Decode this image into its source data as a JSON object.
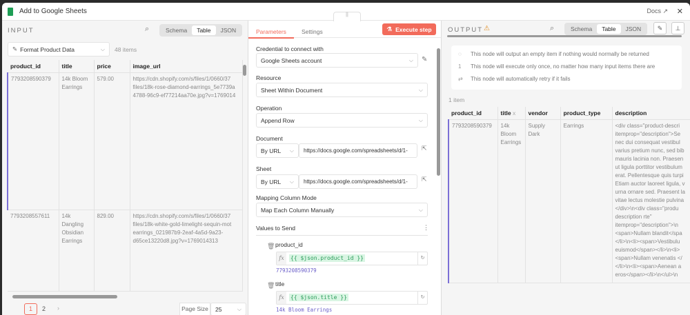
{
  "header": {
    "title": "Add to Google Sheets",
    "docs": "Docs ↗",
    "close": "✕",
    "grip": "||"
  },
  "input": {
    "title": "INPUT",
    "views": [
      "Schema",
      "Table",
      "JSON"
    ],
    "node": "Format Product Data",
    "count": "48 items",
    "columns": [
      "product_id",
      "title",
      "price",
      "image_url"
    ],
    "rows": [
      [
        "7793208590379",
        "14k Bloom\nEarrings",
        "579.00",
        "https://cdn.shopify.com/s/files/1/0660/37\nfiles/18k-rose-diamond-earrings_5e7739a\n4788-96c9-ef77214aa70e.jpg?v=1769014"
      ],
      [
        "7793208557611",
        "14k\nDangling\nObsidian\nEarrings",
        "829.00",
        "https://cdn.shopify.com/s/files/1/0660/37\nfiles/18k-white-gold-limelight-sequin-mot\nearrings_021987b9-2eaf-4a5d-9a23-\nd65ce13220d8.jpg?v=1769014313"
      ]
    ],
    "pages": [
      "1",
      "2"
    ],
    "page_size_label": "Page Size",
    "page_size": "25"
  },
  "params": {
    "tabs": [
      "Parameters",
      "Settings"
    ],
    "execute": "Execute step",
    "credential_label": "Credential to connect with",
    "credential": "Google Sheets account",
    "resource_label": "Resource",
    "resource": "Sheet Within Document",
    "operation_label": "Operation",
    "operation": "Append Row",
    "document_label": "Document",
    "document_mode": "By URL",
    "document_url": "https://docs.google.com/spreadsheets/d/1-",
    "sheet_label": "Sheet",
    "sheet_mode": "By URL",
    "sheet_url": "https://docs.google.com/spreadsheets/d/1-",
    "mapping_label": "Mapping Column Mode",
    "mapping": "Map Each Column Manually",
    "values_label": "Values to Send",
    "fields": [
      {
        "name": "product_id",
        "expr": "{{ $json.product_id }}",
        "result": "7793208590379"
      },
      {
        "name": "title",
        "expr": "{{ $json.title }}",
        "result": "14k Bloom Earrings"
      }
    ]
  },
  "output": {
    "title": "OUTPUT",
    "views": [
      "Schema",
      "Table",
      "JSON"
    ],
    "notes": [
      "This node will output an empty item if nothing would normally be returned",
      "This node will execute only once, no matter how many input items there are",
      "This node will automatically retry if it fails"
    ],
    "count": "1 item",
    "columns": [
      "product_id",
      "title",
      "vendor",
      "product_type",
      "description"
    ],
    "row": [
      "7793208590379",
      "14k\nBloom\nEarrings",
      "Supply\nDark",
      "Earrings",
      "<div class=\"product-descri\nitemprop=\"description\">Se\nnec dui consequat vestibul\nvarius pretium nunc, sed bib\nmauris lacinia non. Praesen\nut ligula porttitor vestibulum\nerat. Pellentesque quis turpi\nEtiam auctor laoreet ligula, v\nurna ornare sed. Praesent la\nvitae lectus molestie pulvina\n</div>\\n<div class=\"produ\ndescription rte\"\nitemprop=\"description\">\\n\n<span>Nullam blandit</spa\n</li>\\n<li><span>Vestibulu\neuismod</span></li>\\n<li>\n<span>Nullam venenatis </\n</li>\\n<li><span>Aenean a\neros</span></li>\\n</ul>\\n"
    ]
  },
  "colors": {
    "accent": "#f26b5b",
    "selection": "#7b6fd6",
    "sheets": "#1e9e55"
  }
}
